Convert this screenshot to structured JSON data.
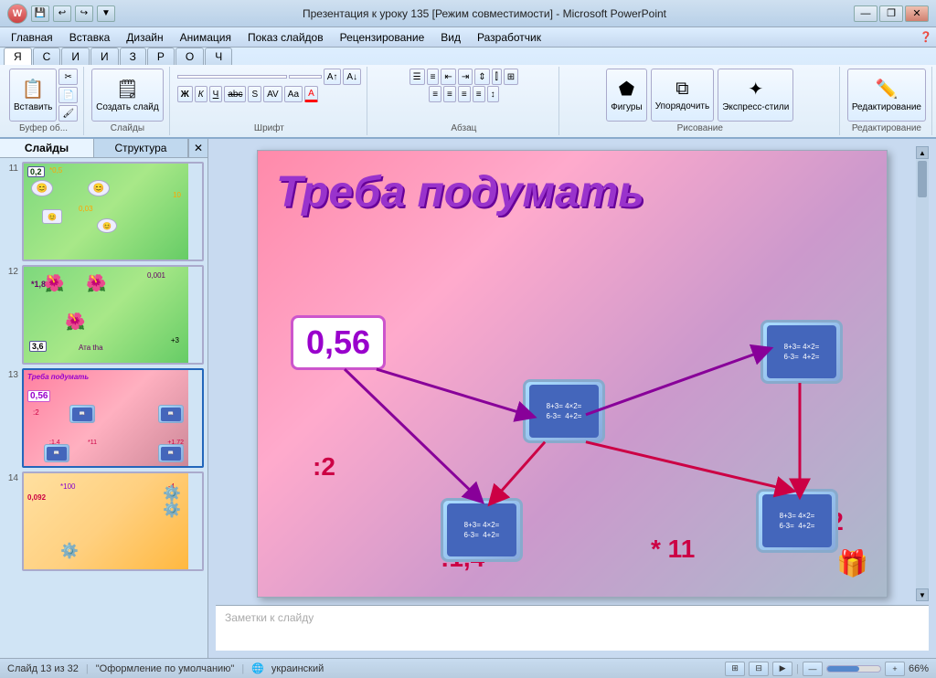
{
  "window": {
    "title": "Презентация к уроку 135 [Режим совместимости] - Microsoft PowerPoint",
    "minimize_label": "—",
    "restore_label": "❐",
    "close_label": "✕"
  },
  "menu": {
    "items": [
      "Главная",
      "Вставка",
      "Дизайн",
      "Анимация",
      "Показ слайдов",
      "Рецензирование",
      "Вид",
      "Разработчик"
    ]
  },
  "ribbon": {
    "groups": [
      "Буфер об...",
      "Слайды",
      "Шрифт",
      "Абзац",
      "Рисование",
      "Редактирование"
    ],
    "buttons": {
      "insert": "Вставить",
      "create": "Создать слайд",
      "figures": "Фигуры",
      "arrange": "Упорядочить",
      "express": "Экспресс-стили",
      "edit": "Редактирование"
    }
  },
  "sidebar": {
    "tab_slides": "Слайды",
    "tab_structure": "Структура",
    "slide_nums": [
      "11",
      "12",
      "13",
      "14"
    ],
    "close_label": "✕"
  },
  "slide": {
    "title": "Треба подумать",
    "value_box": "0,56",
    "op_div2": ":2",
    "op_div14": ":1,4",
    "op_mul11": "* 11",
    "op_plus172": "+1,72",
    "book_text_1": "8+3=\n4×2=\n6-3=",
    "book_text_2": "4×2=\n4+2=",
    "gift": "🎁"
  },
  "notes": {
    "placeholder": "Заметки к слайду"
  },
  "status": {
    "slide_info": "Слайд 13 из 32",
    "theme": "\"Оформление по умолчанию\"",
    "lang": "украинский",
    "zoom": "66%"
  },
  "colors": {
    "slide_bg_start": "#ff8aaa",
    "slide_bg_end": "#aabbcc",
    "title_color": "#9933cc",
    "op_color": "#cc0044",
    "val_box_border": "#cc55cc"
  }
}
